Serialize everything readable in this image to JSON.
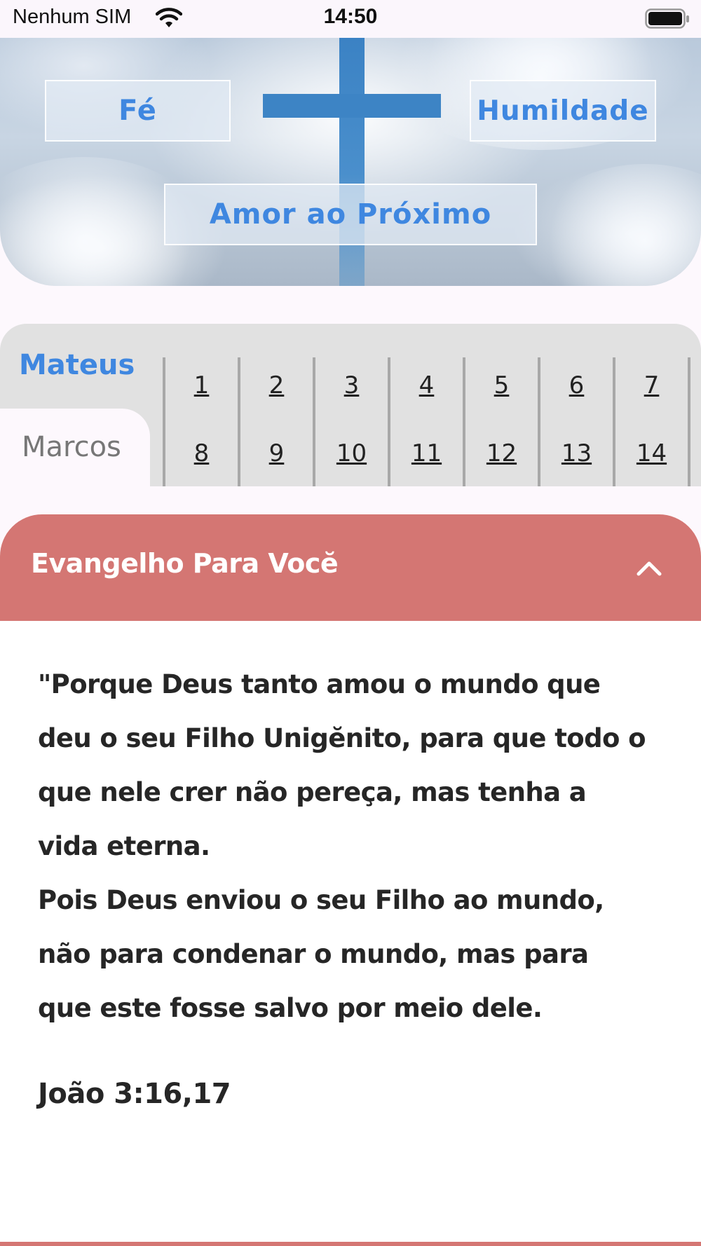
{
  "status_bar": {
    "carrier": "Nenhum SIM",
    "time": "14:50"
  },
  "hero": {
    "buttons": {
      "fe": "Fé",
      "humildade": "Humildade",
      "amor": "Amor ao Próximo"
    }
  },
  "gospels": {
    "active": "Mateus",
    "inactive": "Marcos",
    "chapters_row1": [
      "1",
      "2",
      "3",
      "4",
      "5",
      "6",
      "7"
    ],
    "chapters_row2": [
      "8",
      "9",
      "10",
      "11",
      "12",
      "13",
      "14"
    ]
  },
  "card": {
    "title": "Evangelho Para Vocĕ",
    "verse_lines": [
      "\"Porque Deus tanto amou o mundo que",
      "deu o seu Filho Unigĕnito, para que todo o",
      "que nele crer não pereça, mas tenha a",
      "vida eterna.",
      "Pois Deus enviou o seu Filho ao mundo,",
      "não para condenar o mundo, mas para",
      "que este fosse salvo por meio dele."
    ],
    "reference": "João 3:16,17"
  },
  "colors": {
    "accent_blue": "#3f87e0",
    "card_header": "#d47673",
    "cross_blue": "#3d84c5"
  }
}
